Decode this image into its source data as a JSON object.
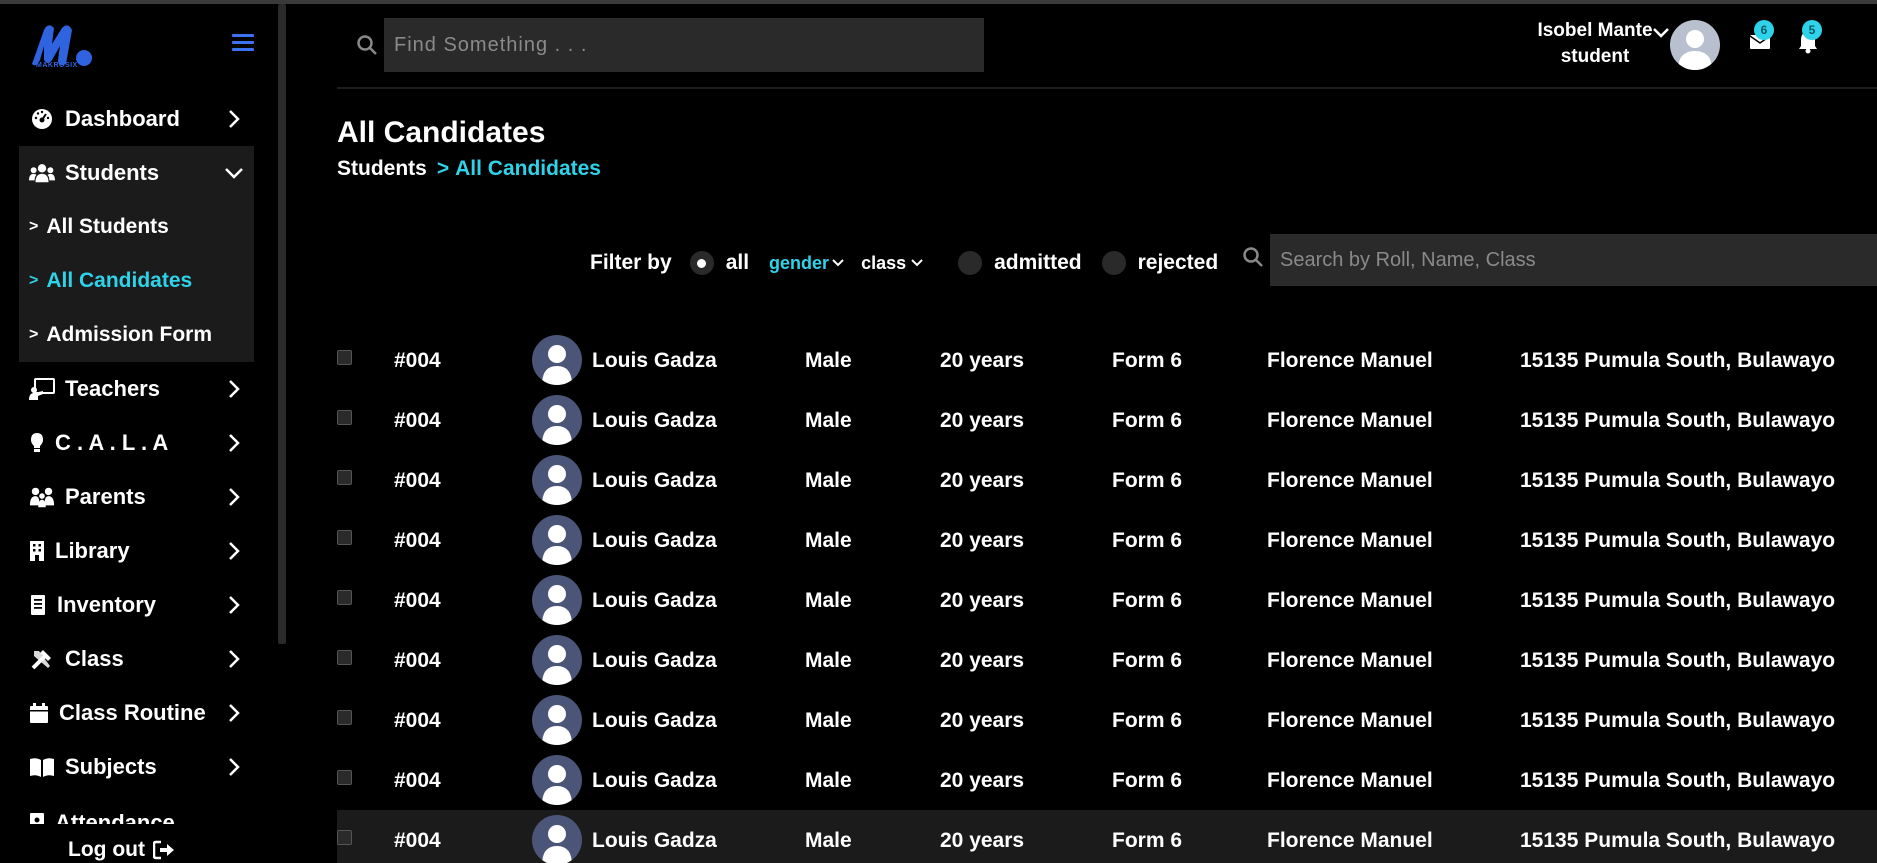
{
  "brand": {
    "logo_text": "MAKROSIX",
    "accent": "#2ed3ea",
    "logo_color": "#2f63e0"
  },
  "sidebar": {
    "items": [
      {
        "label": "Dashboard",
        "icon": "dashboard-icon"
      },
      {
        "label": "Students",
        "icon": "users-icon",
        "expanded": true,
        "children": [
          {
            "label": "All Students"
          },
          {
            "label": "All Candidates",
            "active": true
          },
          {
            "label": "Admission Form"
          }
        ]
      },
      {
        "label": "Teachers",
        "icon": "teacher-icon"
      },
      {
        "label": "C . A . L . A",
        "icon": "lightbulb-icon"
      },
      {
        "label": "Parents",
        "icon": "parents-icon"
      },
      {
        "label": "Library",
        "icon": "building-icon"
      },
      {
        "label": "Inventory",
        "icon": "inventory-icon"
      },
      {
        "label": "Class",
        "icon": "tools-icon"
      },
      {
        "label": "Class Routine",
        "icon": "calendar-icon"
      },
      {
        "label": "Subjects",
        "icon": "book-icon"
      },
      {
        "label": "Attendance",
        "icon": "attendance-icon"
      }
    ],
    "logout_label": "Log out"
  },
  "header": {
    "search_placeholder": "Find Something . . .",
    "user_name": "Isobel Mante",
    "user_role": "student",
    "mail_count": "6",
    "bell_count": "5"
  },
  "page": {
    "title": "All Candidates",
    "breadcrumb": {
      "parent": "Students",
      "separator": ">",
      "current": "All Candidates"
    }
  },
  "filter": {
    "label": "Filter by",
    "all_label": "all",
    "gender_label": "gender",
    "class_label": "class",
    "admitted_label": "admitted",
    "rejected_label": "rejected",
    "search_placeholder": "Search by Roll, Name, Class",
    "selected": "all"
  },
  "rows": [
    {
      "id": "#004",
      "name": "Louis Gadza",
      "gender": "Male",
      "age": "20 years",
      "class": "Form 6",
      "parent": "Florence Manuel",
      "address": "15135 Pumula South, Bulawayo"
    },
    {
      "id": "#004",
      "name": "Louis Gadza",
      "gender": "Male",
      "age": "20 years",
      "class": "Form 6",
      "parent": "Florence Manuel",
      "address": "15135 Pumula South, Bulawayo"
    },
    {
      "id": "#004",
      "name": "Louis Gadza",
      "gender": "Male",
      "age": "20 years",
      "class": "Form 6",
      "parent": "Florence Manuel",
      "address": "15135 Pumula South, Bulawayo"
    },
    {
      "id": "#004",
      "name": "Louis Gadza",
      "gender": "Male",
      "age": "20 years",
      "class": "Form 6",
      "parent": "Florence Manuel",
      "address": "15135 Pumula South, Bulawayo"
    },
    {
      "id": "#004",
      "name": "Louis Gadza",
      "gender": "Male",
      "age": "20 years",
      "class": "Form 6",
      "parent": "Florence Manuel",
      "address": "15135 Pumula South, Bulawayo"
    },
    {
      "id": "#004",
      "name": "Louis Gadza",
      "gender": "Male",
      "age": "20 years",
      "class": "Form 6",
      "parent": "Florence Manuel",
      "address": "15135 Pumula South, Bulawayo"
    },
    {
      "id": "#004",
      "name": "Louis Gadza",
      "gender": "Male",
      "age": "20 years",
      "class": "Form 6",
      "parent": "Florence Manuel",
      "address": "15135 Pumula South, Bulawayo"
    },
    {
      "id": "#004",
      "name": "Louis Gadza",
      "gender": "Male",
      "age": "20 years",
      "class": "Form 6",
      "parent": "Florence Manuel",
      "address": "15135 Pumula South, Bulawayo"
    },
    {
      "id": "#004",
      "name": "Louis Gadza",
      "gender": "Male",
      "age": "20 years",
      "class": "Form 6",
      "parent": "Florence Manuel",
      "address": "15135 Pumula South, Bulawayo",
      "highlight": true
    }
  ]
}
